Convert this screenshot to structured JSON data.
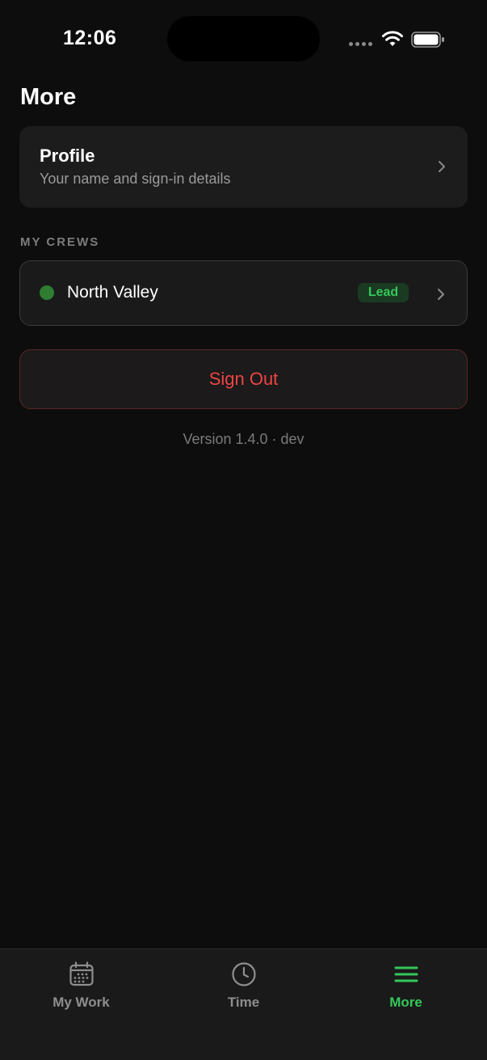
{
  "status_bar": {
    "time": "12:06"
  },
  "header": {
    "title": "More"
  },
  "profile": {
    "title": "Profile",
    "subtitle": "Your name and sign-in details"
  },
  "crews": {
    "section_title": "MY CREWS",
    "items": [
      {
        "name": "North Valley",
        "role": "Lead",
        "status_color": "#2e7d32"
      }
    ]
  },
  "actions": {
    "sign_out_label": "Sign Out"
  },
  "footer": {
    "version": "Version 1.4.0 · dev"
  },
  "tab_bar": {
    "tabs": [
      {
        "label": "My Work",
        "icon": "calendar-icon",
        "active": false
      },
      {
        "label": "Time",
        "icon": "clock-icon",
        "active": false
      },
      {
        "label": "More",
        "icon": "menu-icon",
        "active": true
      }
    ]
  },
  "colors": {
    "accent": "#34c759",
    "danger": "#ef4444",
    "background": "#0d0d0d",
    "card": "#1c1c1c"
  }
}
